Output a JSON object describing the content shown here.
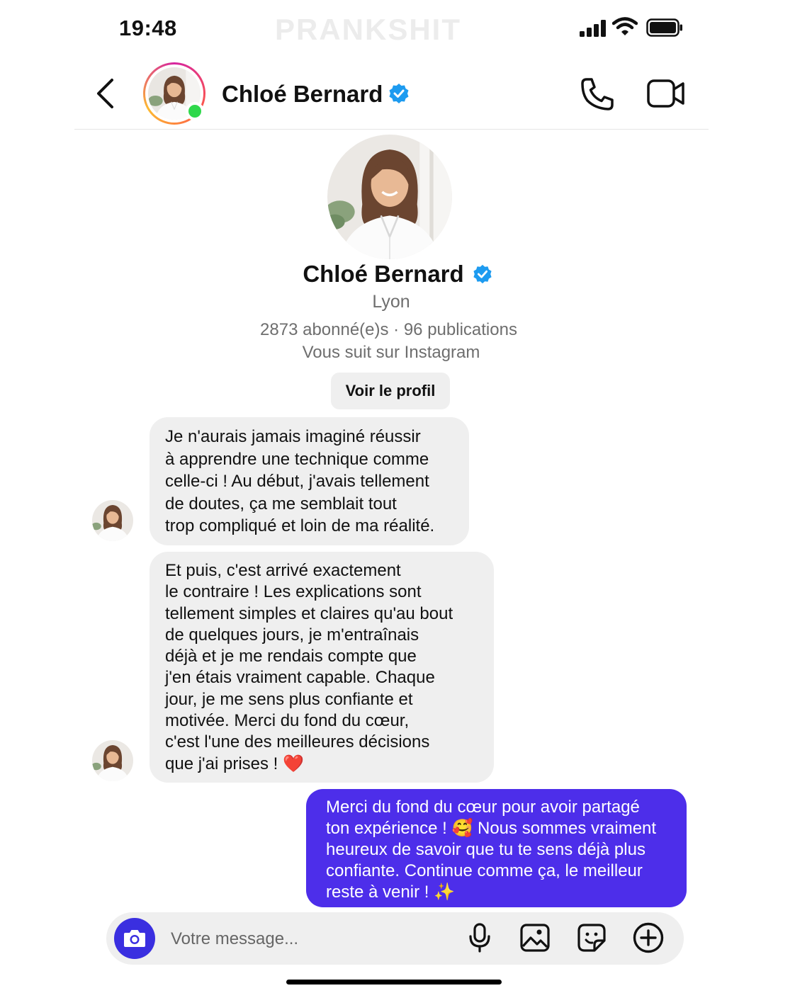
{
  "status_bar": {
    "time": "19:48",
    "watermark": "PRANKSHIT",
    "icons": [
      "signal-icon",
      "wifi-icon",
      "battery-icon"
    ]
  },
  "header": {
    "back_icon": "chevron-left-icon",
    "contact_name": "Chloé Bernard",
    "verified_icon": "verified-badge-icon",
    "online": true,
    "actions": [
      "phone-icon",
      "video-camera-icon"
    ]
  },
  "profile": {
    "name": "Chloé Bernard",
    "city": "Lyon",
    "stats": "2873 abonné(e)s · 96 publications",
    "follow_note": "Vous suit sur Instagram",
    "view_profile_label": "Voir le profil"
  },
  "messages": [
    {
      "direction": "incoming",
      "lines": [
        "Je n'aurais jamais imaginé réussir",
        "à apprendre une technique comme",
        "celle-ci ! Au début, j'avais tellement",
        "de doutes, ça me semblait tout",
        "trop compliqué et loin de ma réalité."
      ]
    },
    {
      "direction": "incoming",
      "lines": [
        "Et puis, c'est arrivé exactement",
        "le contraire ! Les explications sont",
        "tellement simples et claires qu'au bout",
        "de quelques jours, je m'entraînais",
        "déjà et je me rendais compte que",
        "j'en étais vraiment capable. Chaque",
        "jour, je me sens plus confiante et",
        "motivée. Merci du fond du cœur,",
        "c'est l'une des meilleures décisions",
        "que j'ai prises ! ❤️"
      ]
    },
    {
      "direction": "outgoing",
      "lines": [
        "Merci du fond du cœur pour avoir partagé",
        "ton expérience ! 🥰 Nous sommes vraiment",
        "heureux de savoir que tu te sens déjà plus",
        "confiante. Continue comme ça, le meilleur",
        "reste à venir ! ✨"
      ]
    }
  ],
  "composer": {
    "camera_icon": "camera-icon",
    "placeholder": "Votre message...",
    "actions": [
      "microphone-icon",
      "image-icon",
      "sticker-icon",
      "plus-circle-icon"
    ]
  },
  "colors": {
    "outgoing_bubble": "#4d2eea",
    "incoming_bubble": "#efefef",
    "camera_button": "#3a2fe0",
    "verified": "#1d9bf0",
    "online": "#2fd84b"
  }
}
